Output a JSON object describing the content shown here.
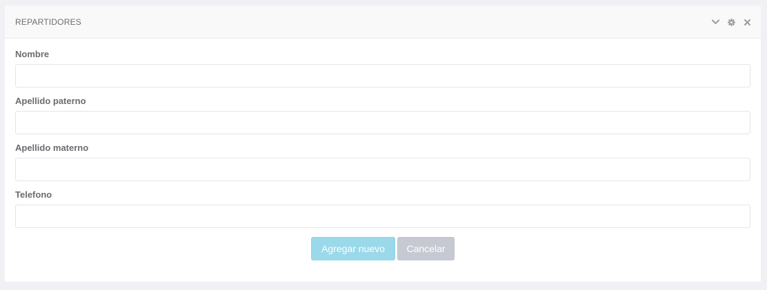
{
  "panel": {
    "title": "REPARTIDORES",
    "tools": [
      {
        "icon": "chevron-down-icon"
      },
      {
        "icon": "gear-icon"
      },
      {
        "icon": "close-icon"
      }
    ]
  },
  "form": {
    "fields": [
      {
        "label": "Nombre",
        "value": "",
        "placeholder": ""
      },
      {
        "label": "Apellido paterno",
        "value": "",
        "placeholder": ""
      },
      {
        "label": "Apellido materno",
        "value": "",
        "placeholder": ""
      },
      {
        "label": "Telefono",
        "value": "",
        "placeholder": ""
      }
    ],
    "submit_label": "Agregar nuevo",
    "cancel_label": "Cancelar"
  },
  "colors": {
    "page_background": "#f0f0f5",
    "header_background": "#f9f9f9",
    "text": "#6a6c6f",
    "primary_button": "#9ad9ea",
    "secondary_button": "#c6c9d1",
    "icon": "#9d9fa2"
  }
}
